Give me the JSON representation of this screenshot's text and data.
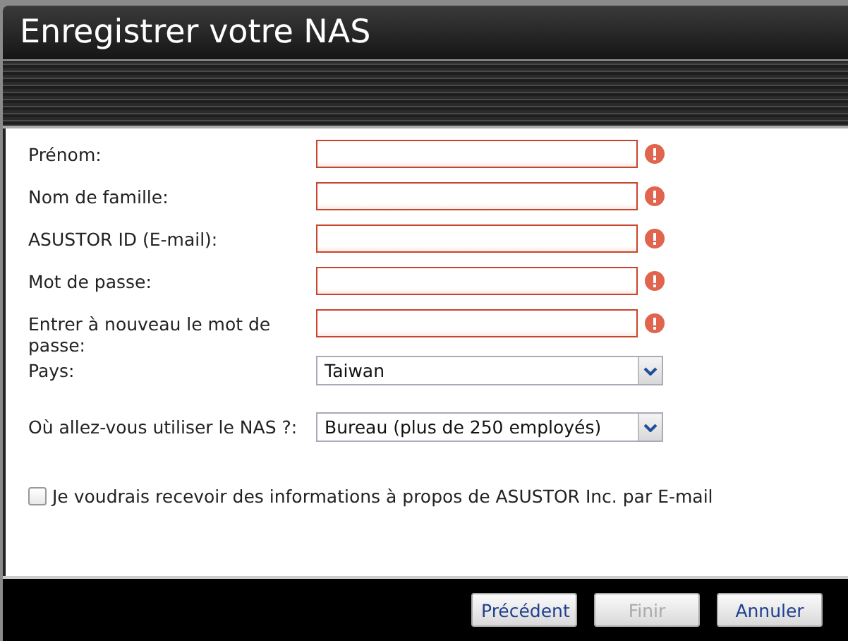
{
  "window": {
    "title": "Enregistrer votre NAS"
  },
  "fields": [
    {
      "kind": "text",
      "label": "Prénom:",
      "invalid": true
    },
    {
      "kind": "text",
      "label": "Nom de famille:",
      "invalid": true
    },
    {
      "kind": "text",
      "label": "ASUSTOR ID (E-mail):",
      "invalid": true
    },
    {
      "kind": "text",
      "label": "Mot de passe:",
      "invalid": true
    },
    {
      "kind": "text",
      "label": "Entrer à nouveau le mot de passe:",
      "invalid": true
    },
    {
      "kind": "select",
      "label": "Pays:",
      "value": "Taiwan"
    },
    {
      "kind": "select",
      "label": "Où allez-vous utiliser le NAS ?:",
      "value": "Bureau (plus de 250 employés)"
    }
  ],
  "newsletter": {
    "label": "Je voudrais recevoir des informations à propos de ASUSTOR Inc. par E-mail",
    "checked": false
  },
  "buttons": [
    {
      "label": "Précédent",
      "disabled": false
    },
    {
      "label": "Finir",
      "disabled": true
    },
    {
      "label": "Annuler",
      "disabled": false
    }
  ]
}
